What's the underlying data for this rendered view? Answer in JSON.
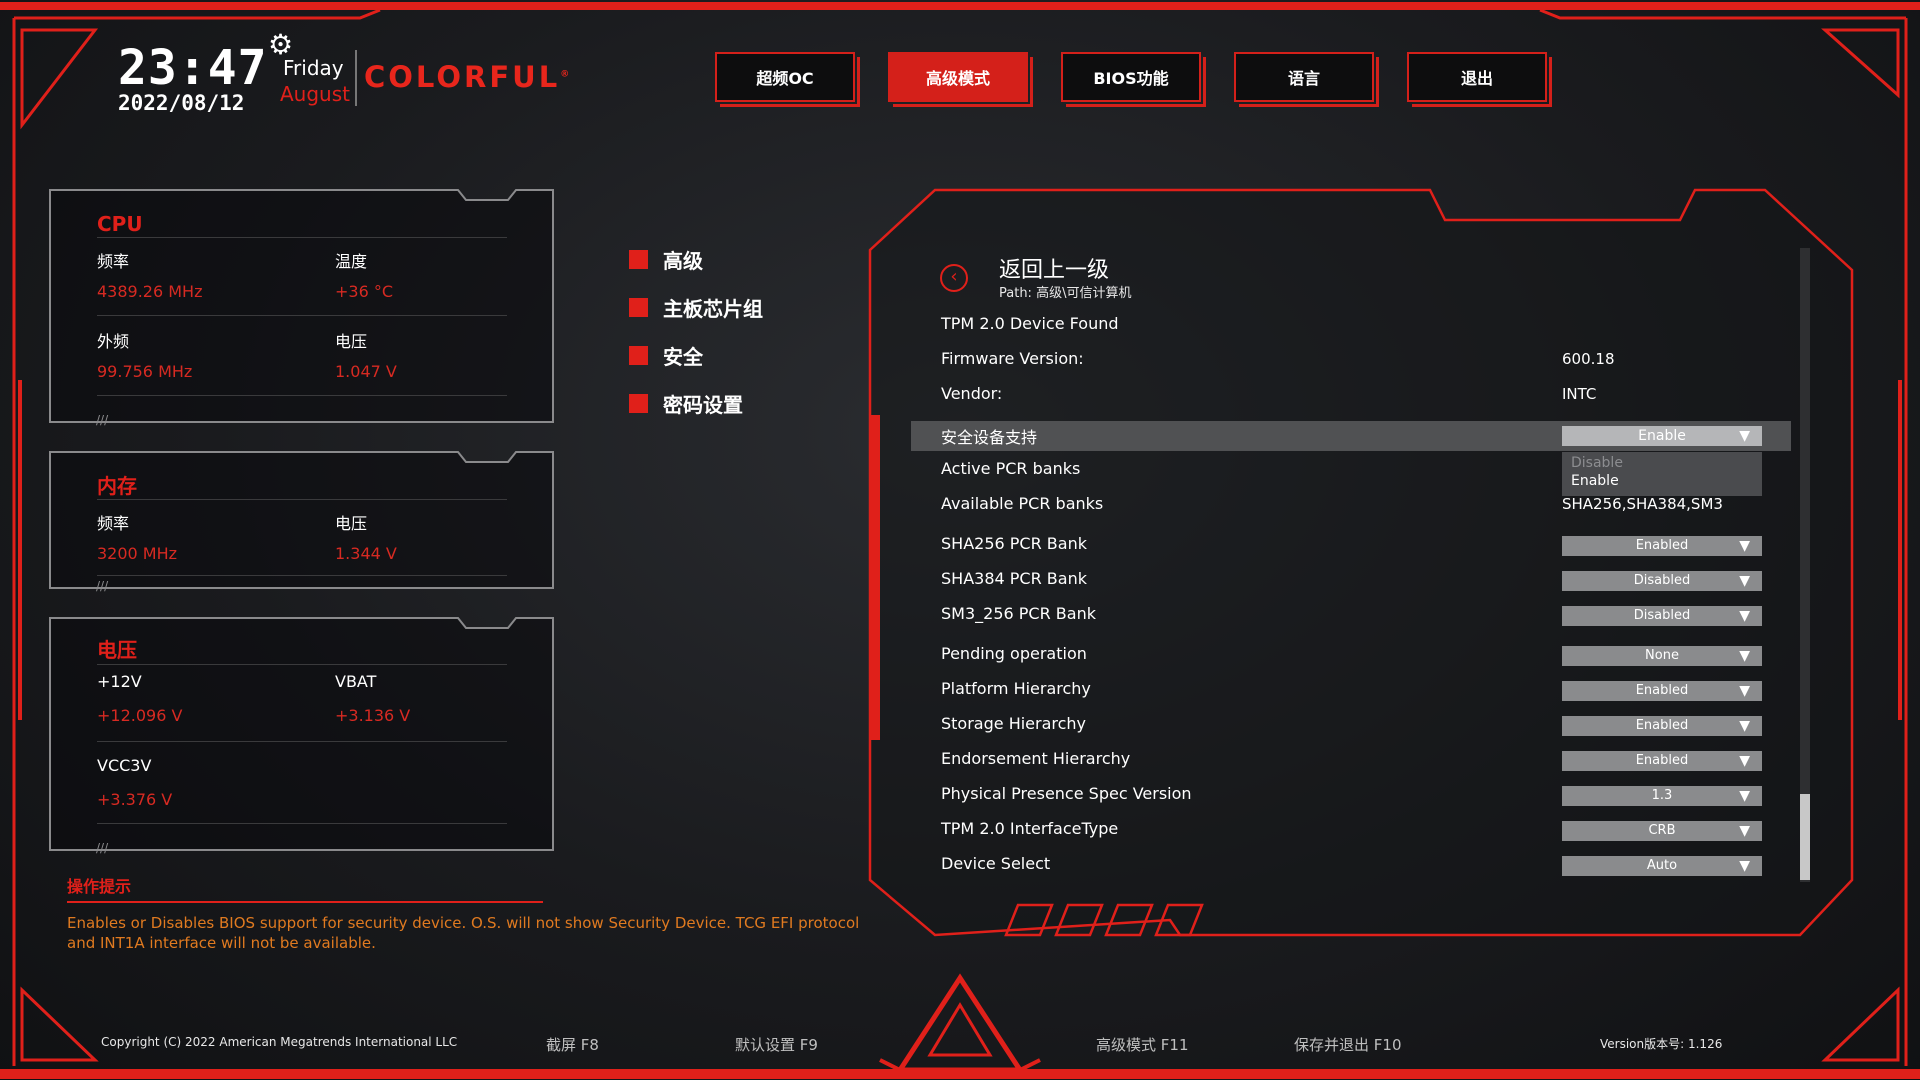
{
  "header": {
    "time": "23:47",
    "date": "2022/08/12",
    "weekday": "Friday",
    "month": "August",
    "brand": "COLORFUL",
    "brand_mark": "®"
  },
  "top_tabs": [
    {
      "label": "超频OC",
      "active": false
    },
    {
      "label": "高级模式",
      "active": true
    },
    {
      "label": "BIOS功能",
      "active": false
    },
    {
      "label": "语言",
      "active": false
    },
    {
      "label": "退出",
      "active": false
    }
  ],
  "cpu": {
    "title": "CPU",
    "freq_label": "频率",
    "freq_value": "4389.26 MHz",
    "temp_label": "温度",
    "temp_value": "+36 °C",
    "bclk_label": "外频",
    "bclk_value": "99.756 MHz",
    "volt_label": "电压",
    "volt_value": "1.047 V"
  },
  "memory": {
    "title": "内存",
    "freq_label": "频率",
    "freq_value": "3200 MHz",
    "volt_label": "电压",
    "volt_value": "1.344 V"
  },
  "voltage": {
    "title": "电压",
    "v12_label": "+12V",
    "v12_value": "+12.096 V",
    "vbat_label": "VBAT",
    "vbat_value": "+3.136 V",
    "vcc3v_label": "VCC3V",
    "vcc3v_value": "+3.376 V"
  },
  "side_menu": [
    "高级",
    "主板芯片组",
    "安全",
    "密码设置"
  ],
  "hint": {
    "title": "操作提示",
    "text": "Enables or Disables BIOS support for security device. O.S. will not show Security Device. TCG EFI protocol and INT1A interface will not be available."
  },
  "main": {
    "back_title": "返回上一级",
    "path": "Path: 高级\\可信计算机",
    "tpm_found": "TPM 2.0 Device Found",
    "firmware_label": "Firmware Version:",
    "firmware_value": "600.18",
    "vendor_label": "Vendor:",
    "vendor_value": "INTC",
    "security_label": "安全设备支持",
    "security_value": "Enable",
    "security_options": [
      "Disable",
      "Enable"
    ],
    "active_pcr_label": "Active PCR banks",
    "available_pcr_label": "Available PCR banks",
    "available_pcr_value": "SHA256,SHA384,SM3",
    "settings": [
      {
        "label": "SHA256 PCR Bank",
        "value": "Enabled"
      },
      {
        "label": "SHA384 PCR Bank",
        "value": "Disabled"
      },
      {
        "label": "SM3_256 PCR Bank",
        "value": "Disabled"
      },
      {
        "label": "Pending operation",
        "value": "None"
      },
      {
        "label": "Platform Hierarchy",
        "value": "Enabled"
      },
      {
        "label": "Storage Hierarchy",
        "value": "Enabled"
      },
      {
        "label": "Endorsement Hierarchy",
        "value": "Enabled"
      },
      {
        "label": "Physical Presence Spec Version",
        "value": "1.3"
      },
      {
        "label": "TPM 2.0 InterfaceType",
        "value": "CRB"
      },
      {
        "label": "Device Select",
        "value": "Auto"
      }
    ]
  },
  "footer": {
    "copyright": "Copyright (C) 2022 American Megatrends International LLC",
    "screenshot": "截屏 F8",
    "defaults": "默认设置 F9",
    "advanced": "高级模式 F11",
    "save_exit": "保存并退出 F10",
    "version": "Version版本号: 1.126"
  },
  "colors": {
    "accent": "#e0201a",
    "value_red": "#d72a22",
    "hint_orange": "#e07a20"
  },
  "icons": [
    "gear-icon",
    "back-arrow-icon",
    "dropdown-arrow-icon",
    "colorful-emblem-icon"
  ]
}
